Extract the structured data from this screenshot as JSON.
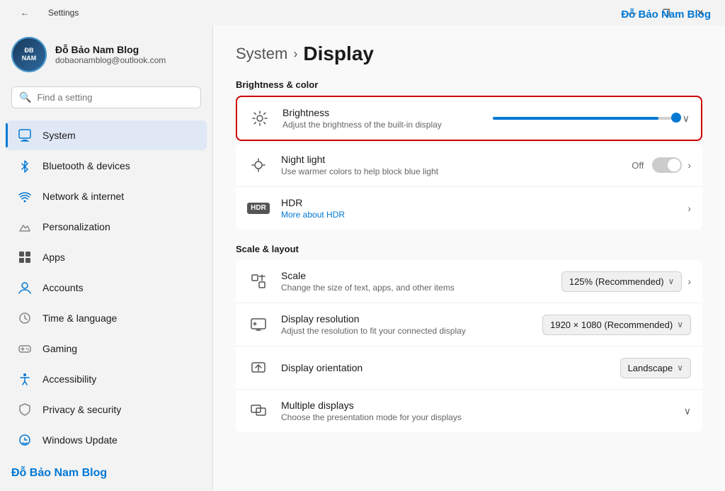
{
  "titlebar": {
    "back_icon": "←",
    "title": "Settings",
    "btn_minimize": "—",
    "btn_maximize": "❐",
    "btn_close": "✕"
  },
  "brand": "Đỗ Bảo Nam Blog",
  "user": {
    "name": "Đỗ Bảo Nam Blog",
    "email": "dobaonamblog@outlook.com",
    "avatar_label": "ĐB\nNAM"
  },
  "search": {
    "placeholder": "Find a setting"
  },
  "nav": {
    "items": [
      {
        "id": "system",
        "label": "System",
        "active": true,
        "icon_color": "#0078d4"
      },
      {
        "id": "bluetooth",
        "label": "Bluetooth & devices",
        "active": false,
        "icon_color": "#0078d4"
      },
      {
        "id": "network",
        "label": "Network & internet",
        "active": false,
        "icon_color": "#0078d4"
      },
      {
        "id": "personalization",
        "label": "Personalization",
        "active": false,
        "icon_color": "#555"
      },
      {
        "id": "apps",
        "label": "Apps",
        "active": false,
        "icon_color": "#555"
      },
      {
        "id": "accounts",
        "label": "Accounts",
        "active": false,
        "icon_color": "#0078d4"
      },
      {
        "id": "time",
        "label": "Time & language",
        "active": false,
        "icon_color": "#555"
      },
      {
        "id": "gaming",
        "label": "Gaming",
        "active": false,
        "icon_color": "#555"
      },
      {
        "id": "accessibility",
        "label": "Accessibility",
        "active": false,
        "icon_color": "#0078d4"
      },
      {
        "id": "privacy",
        "label": "Privacy & security",
        "active": false,
        "icon_color": "#555"
      },
      {
        "id": "update",
        "label": "Windows Update",
        "active": false,
        "icon_color": "#0078d4"
      }
    ]
  },
  "sidebar_footer_label": "Đỗ Bảo Nam Blog",
  "main": {
    "breadcrumb_parent": "System",
    "breadcrumb_separator": "›",
    "breadcrumb_current": "Display",
    "sections": [
      {
        "id": "brightness-color",
        "header": "Brightness & color",
        "items": [
          {
            "id": "brightness",
            "icon": "☀",
            "title": "Brightness",
            "desc": "Adjust the brightness of the built-in display",
            "control_type": "slider",
            "slider_value": 90,
            "highlighted": true
          },
          {
            "id": "night-light",
            "icon": "☀",
            "title": "Night light",
            "desc": "Use warmer colors to help block blue light",
            "control_type": "toggle",
            "toggle_state": false,
            "toggle_label": "Off"
          },
          {
            "id": "hdr",
            "icon": "HDR",
            "title": "HDR",
            "desc_link": "More about HDR",
            "control_type": "chevron"
          }
        ]
      },
      {
        "id": "scale-layout",
        "header": "Scale & layout",
        "items": [
          {
            "id": "scale",
            "icon": "⊞",
            "title": "Scale",
            "desc": "Change the size of text, apps, and other items",
            "control_type": "dropdown",
            "dropdown_value": "125% (Recommended)"
          },
          {
            "id": "display-resolution",
            "icon": "⊟",
            "title": "Display resolution",
            "desc": "Adjust the resolution to fit your connected display",
            "control_type": "dropdown",
            "dropdown_value": "1920 × 1080 (Recommended)"
          },
          {
            "id": "display-orientation",
            "icon": "⊡",
            "title": "Display orientation",
            "desc": "",
            "control_type": "dropdown",
            "dropdown_value": "Landscape"
          },
          {
            "id": "multiple-displays",
            "icon": "⊞",
            "title": "Multiple displays",
            "desc": "Choose the presentation mode for your displays",
            "control_type": "chevron-down"
          }
        ]
      }
    ]
  }
}
